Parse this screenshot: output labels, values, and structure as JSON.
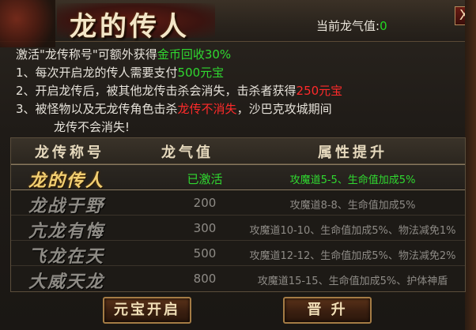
{
  "window": {
    "title": "龙的传人",
    "qi_label": "当前龙气值:",
    "qi_value": "0",
    "close_label": "X"
  },
  "description": {
    "intro_prefix": "激活\"龙传称号\"可额外获得",
    "intro_highlight": "金币回收30%",
    "line1_prefix": "1、每次开启龙的传人需要支付",
    "line1_highlight": "500元宝",
    "line2_prefix": "2、开启龙传后，被其他龙传击杀会消失，击杀者获得",
    "line2_highlight": "250元宝",
    "line3_prefix": "3、被怪物以及无龙传角色击杀",
    "line3_highlight": "龙传不消失",
    "line3_suffix": "，沙巴克攻城期间",
    "line4": "龙传不会消失!"
  },
  "table": {
    "headers": [
      "龙传称号",
      "龙气值",
      "属性提升"
    ],
    "rows": [
      {
        "name": "龙的传人",
        "qi": "已激活",
        "attr": "攻魔道5-5、生命值加成5%"
      },
      {
        "name": "龙战于野",
        "qi": "200",
        "attr": "攻魔道8-8、生命值加成5%"
      },
      {
        "name": "亢龙有悔",
        "qi": "300",
        "attr": "攻魔道10-10、生命值加成5%、物法减免1%"
      },
      {
        "name": "飞龙在天",
        "qi": "500",
        "attr": "攻魔道12-12、生命值加成5%、物法减免2%"
      },
      {
        "name": "大威天龙",
        "qi": "800",
        "attr": "攻魔道15-15、生命值加成5%、护体神盾"
      }
    ]
  },
  "buttons": {
    "activate": "元宝开启",
    "upgrade": "晋 升"
  },
  "colors": {
    "highlight_green": "#30d830",
    "highlight_red": "#ff2a2a",
    "active_gold": "#f2cf72"
  }
}
